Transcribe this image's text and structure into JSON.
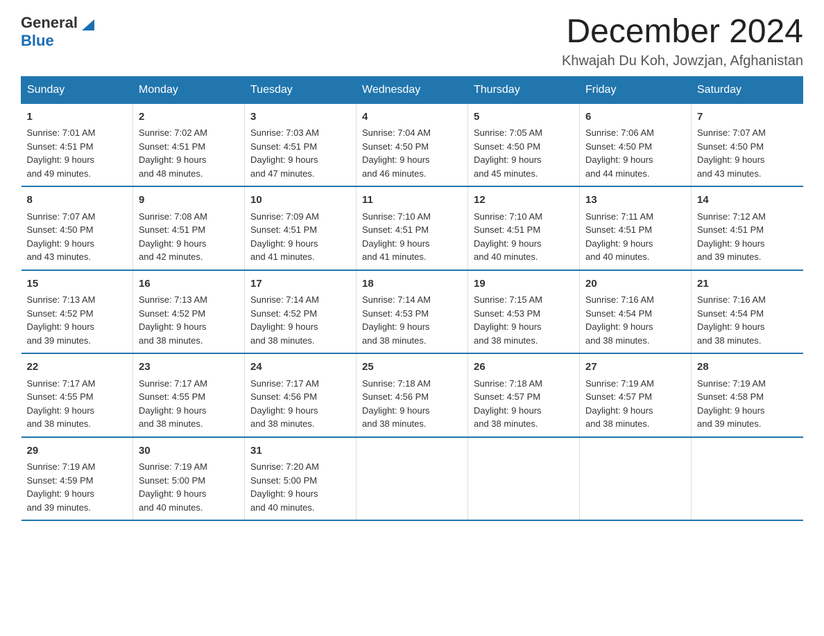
{
  "header": {
    "logo_general": "General",
    "logo_blue": "Blue",
    "month_title": "December 2024",
    "location": "Khwajah Du Koh, Jowzjan, Afghanistan"
  },
  "days_of_week": [
    "Sunday",
    "Monday",
    "Tuesday",
    "Wednesday",
    "Thursday",
    "Friday",
    "Saturday"
  ],
  "weeks": [
    [
      {
        "day": "1",
        "sunrise": "7:01 AM",
        "sunset": "4:51 PM",
        "daylight": "9 hours and 49 minutes."
      },
      {
        "day": "2",
        "sunrise": "7:02 AM",
        "sunset": "4:51 PM",
        "daylight": "9 hours and 48 minutes."
      },
      {
        "day": "3",
        "sunrise": "7:03 AM",
        "sunset": "4:51 PM",
        "daylight": "9 hours and 47 minutes."
      },
      {
        "day": "4",
        "sunrise": "7:04 AM",
        "sunset": "4:50 PM",
        "daylight": "9 hours and 46 minutes."
      },
      {
        "day": "5",
        "sunrise": "7:05 AM",
        "sunset": "4:50 PM",
        "daylight": "9 hours and 45 minutes."
      },
      {
        "day": "6",
        "sunrise": "7:06 AM",
        "sunset": "4:50 PM",
        "daylight": "9 hours and 44 minutes."
      },
      {
        "day": "7",
        "sunrise": "7:07 AM",
        "sunset": "4:50 PM",
        "daylight": "9 hours and 43 minutes."
      }
    ],
    [
      {
        "day": "8",
        "sunrise": "7:07 AM",
        "sunset": "4:50 PM",
        "daylight": "9 hours and 43 minutes."
      },
      {
        "day": "9",
        "sunrise": "7:08 AM",
        "sunset": "4:51 PM",
        "daylight": "9 hours and 42 minutes."
      },
      {
        "day": "10",
        "sunrise": "7:09 AM",
        "sunset": "4:51 PM",
        "daylight": "9 hours and 41 minutes."
      },
      {
        "day": "11",
        "sunrise": "7:10 AM",
        "sunset": "4:51 PM",
        "daylight": "9 hours and 41 minutes."
      },
      {
        "day": "12",
        "sunrise": "7:10 AM",
        "sunset": "4:51 PM",
        "daylight": "9 hours and 40 minutes."
      },
      {
        "day": "13",
        "sunrise": "7:11 AM",
        "sunset": "4:51 PM",
        "daylight": "9 hours and 40 minutes."
      },
      {
        "day": "14",
        "sunrise": "7:12 AM",
        "sunset": "4:51 PM",
        "daylight": "9 hours and 39 minutes."
      }
    ],
    [
      {
        "day": "15",
        "sunrise": "7:13 AM",
        "sunset": "4:52 PM",
        "daylight": "9 hours and 39 minutes."
      },
      {
        "day": "16",
        "sunrise": "7:13 AM",
        "sunset": "4:52 PM",
        "daylight": "9 hours and 38 minutes."
      },
      {
        "day": "17",
        "sunrise": "7:14 AM",
        "sunset": "4:52 PM",
        "daylight": "9 hours and 38 minutes."
      },
      {
        "day": "18",
        "sunrise": "7:14 AM",
        "sunset": "4:53 PM",
        "daylight": "9 hours and 38 minutes."
      },
      {
        "day": "19",
        "sunrise": "7:15 AM",
        "sunset": "4:53 PM",
        "daylight": "9 hours and 38 minutes."
      },
      {
        "day": "20",
        "sunrise": "7:16 AM",
        "sunset": "4:54 PM",
        "daylight": "9 hours and 38 minutes."
      },
      {
        "day": "21",
        "sunrise": "7:16 AM",
        "sunset": "4:54 PM",
        "daylight": "9 hours and 38 minutes."
      }
    ],
    [
      {
        "day": "22",
        "sunrise": "7:17 AM",
        "sunset": "4:55 PM",
        "daylight": "9 hours and 38 minutes."
      },
      {
        "day": "23",
        "sunrise": "7:17 AM",
        "sunset": "4:55 PM",
        "daylight": "9 hours and 38 minutes."
      },
      {
        "day": "24",
        "sunrise": "7:17 AM",
        "sunset": "4:56 PM",
        "daylight": "9 hours and 38 minutes."
      },
      {
        "day": "25",
        "sunrise": "7:18 AM",
        "sunset": "4:56 PM",
        "daylight": "9 hours and 38 minutes."
      },
      {
        "day": "26",
        "sunrise": "7:18 AM",
        "sunset": "4:57 PM",
        "daylight": "9 hours and 38 minutes."
      },
      {
        "day": "27",
        "sunrise": "7:19 AM",
        "sunset": "4:57 PM",
        "daylight": "9 hours and 38 minutes."
      },
      {
        "day": "28",
        "sunrise": "7:19 AM",
        "sunset": "4:58 PM",
        "daylight": "9 hours and 39 minutes."
      }
    ],
    [
      {
        "day": "29",
        "sunrise": "7:19 AM",
        "sunset": "4:59 PM",
        "daylight": "9 hours and 39 minutes."
      },
      {
        "day": "30",
        "sunrise": "7:19 AM",
        "sunset": "5:00 PM",
        "daylight": "9 hours and 40 minutes."
      },
      {
        "day": "31",
        "sunrise": "7:20 AM",
        "sunset": "5:00 PM",
        "daylight": "9 hours and 40 minutes."
      },
      null,
      null,
      null,
      null
    ]
  ]
}
